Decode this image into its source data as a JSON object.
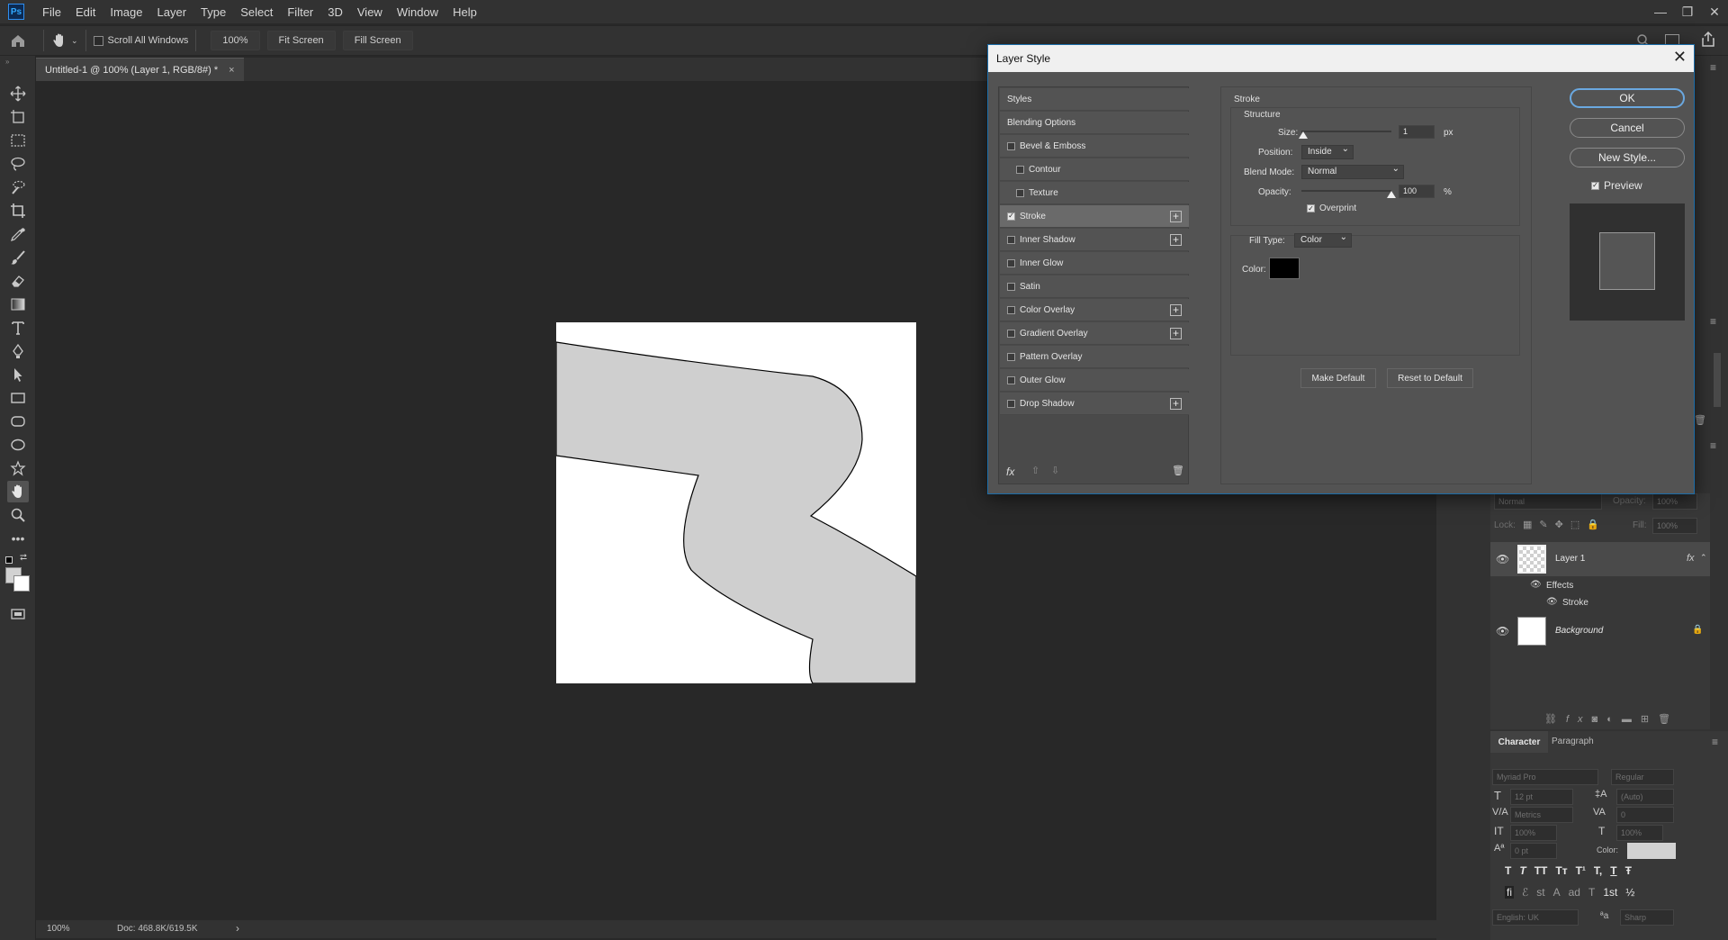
{
  "app": {
    "logo": "Ps",
    "menu": [
      "File",
      "Edit",
      "Image",
      "Layer",
      "Type",
      "Select",
      "Filter",
      "3D",
      "View",
      "Window",
      "Help"
    ]
  },
  "options_bar": {
    "scroll_all_windows": "Scroll All Windows",
    "zoom_value": "100%",
    "fit_screen": "Fit Screen",
    "fill_screen": "Fill Screen"
  },
  "document": {
    "tab_title": "Untitled-1 @ 100% (Layer 1, RGB/8#) *",
    "tab_close": "×",
    "status_zoom": "100%",
    "status_doc": "Doc: 468.8K/619.5K",
    "status_arrow": "›"
  },
  "dialog": {
    "title": "Layer Style",
    "close": "✕",
    "styles_header": "Styles",
    "blending_options": "Blending Options",
    "effects": [
      {
        "label": "Bevel & Emboss",
        "checked": false,
        "plus": false,
        "indent": false
      },
      {
        "label": "Contour",
        "checked": false,
        "plus": false,
        "indent": true
      },
      {
        "label": "Texture",
        "checked": false,
        "plus": false,
        "indent": true
      },
      {
        "label": "Stroke",
        "checked": true,
        "plus": true,
        "indent": false
      },
      {
        "label": "Inner Shadow",
        "checked": false,
        "plus": true,
        "indent": false
      },
      {
        "label": "Inner Glow",
        "checked": false,
        "plus": false,
        "indent": false
      },
      {
        "label": "Satin",
        "checked": false,
        "plus": false,
        "indent": false
      },
      {
        "label": "Color Overlay",
        "checked": false,
        "plus": true,
        "indent": false
      },
      {
        "label": "Gradient Overlay",
        "checked": false,
        "plus": true,
        "indent": false
      },
      {
        "label": "Pattern Overlay",
        "checked": false,
        "plus": false,
        "indent": false
      },
      {
        "label": "Outer Glow",
        "checked": false,
        "plus": false,
        "indent": false
      },
      {
        "label": "Drop Shadow",
        "checked": false,
        "plus": true,
        "indent": false
      }
    ],
    "fx_label": "fx",
    "stroke": {
      "section_title": "Stroke",
      "structure_title": "Structure",
      "size_label": "Size:",
      "size_value": "1",
      "size_unit": "px",
      "position_label": "Position:",
      "position_value": "Inside",
      "blend_mode_label": "Blend Mode:",
      "blend_mode_value": "Normal",
      "opacity_label": "Opacity:",
      "opacity_value": "100",
      "opacity_unit": "%",
      "overprint_label": "Overprint",
      "overprint_checked": true,
      "fill_type_label": "Fill Type:",
      "fill_type_value": "Color",
      "color_label": "Color:",
      "color_value": "#000000",
      "make_default": "Make Default",
      "reset_default": "Reset to Default"
    },
    "buttons": {
      "ok": "OK",
      "cancel": "Cancel",
      "new_style": "New Style...",
      "preview": "Preview"
    }
  },
  "layers_panel": {
    "blend_mode": "Normal",
    "opacity_label": "Opacity:",
    "opacity_value": "100%",
    "lock_label": "Lock:",
    "fill_label": "Fill:",
    "fill_value": "100%",
    "layers": [
      {
        "name": "Layer 1",
        "fx": "fx"
      },
      {
        "name": "Background",
        "italic": true
      }
    ],
    "effects_label": "Effects",
    "stroke_effect": "Stroke"
  },
  "character_panel": {
    "tabs": [
      "Character",
      "Paragraph"
    ],
    "font_family": "Myriad Pro",
    "font_style": "Regular",
    "font_size": "12 pt",
    "leading": "(Auto)",
    "kerning": "Metrics",
    "tracking": "0",
    "vertical_scale": "100%",
    "horizontal_scale": "100%",
    "baseline_shift": "0 pt",
    "color_label": "Color:",
    "language": "English: UK",
    "antialias": "Sharp",
    "type_buttons": [
      "T",
      "T",
      "TT",
      "Tт",
      "T¹",
      "T,",
      "T",
      "Ŧ"
    ],
    "opentype_buttons": [
      "fi",
      "ℰ",
      "st",
      "A",
      "ad",
      "T",
      "1st",
      "½"
    ]
  }
}
